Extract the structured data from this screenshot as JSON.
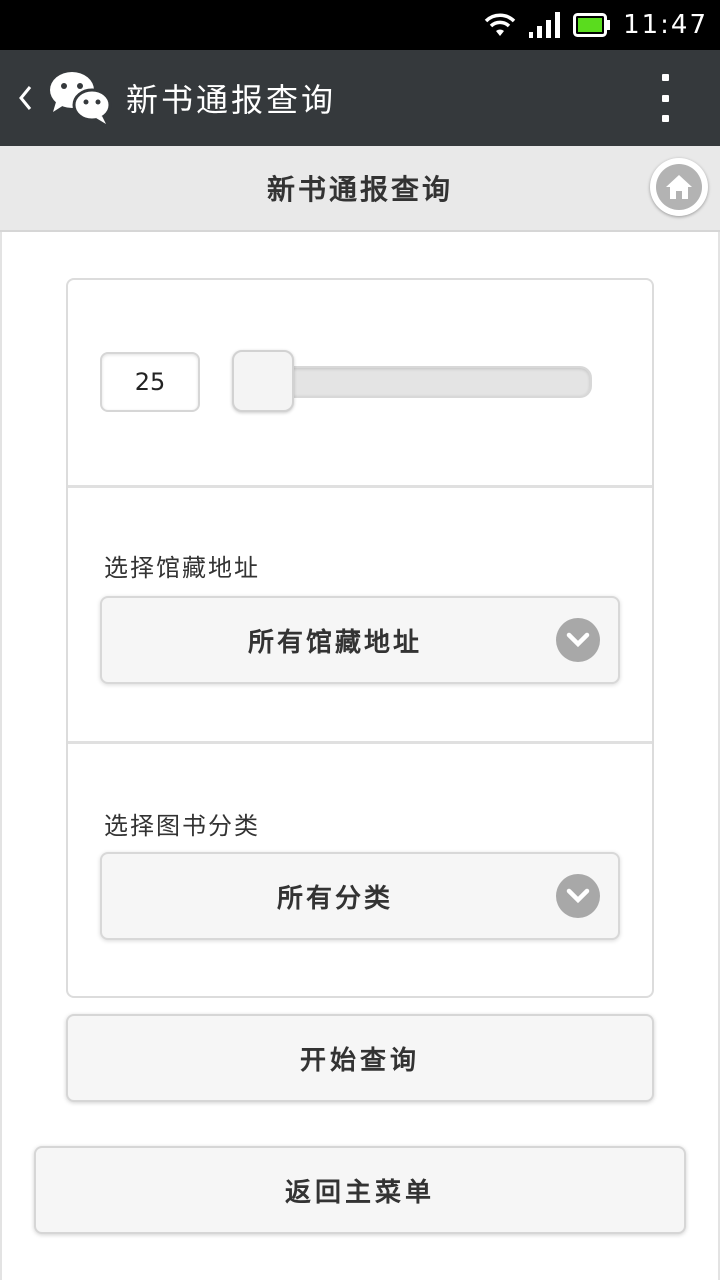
{
  "status_bar": {
    "time": "11:47",
    "icons": [
      "wifi-icon",
      "signal-icon",
      "battery-icon"
    ],
    "battery_color": "#5adc1e"
  },
  "header": {
    "app_icon": "wechat-icon",
    "title": "新书通报查询"
  },
  "page": {
    "title": "新书通报查询",
    "home_icon": "home-icon"
  },
  "form": {
    "count_value": "25",
    "location": {
      "label": "选择馆藏地址",
      "selected": "所有馆藏地址"
    },
    "category": {
      "label": "选择图书分类",
      "selected": "所有分类"
    },
    "submit_label": "开始查询"
  },
  "footer": {
    "back_label": "返回主菜单"
  },
  "colors": {
    "header_bg": "#35393c",
    "page_bar_bg": "#e9e9e9",
    "button_bg": "#f6f6f6"
  }
}
